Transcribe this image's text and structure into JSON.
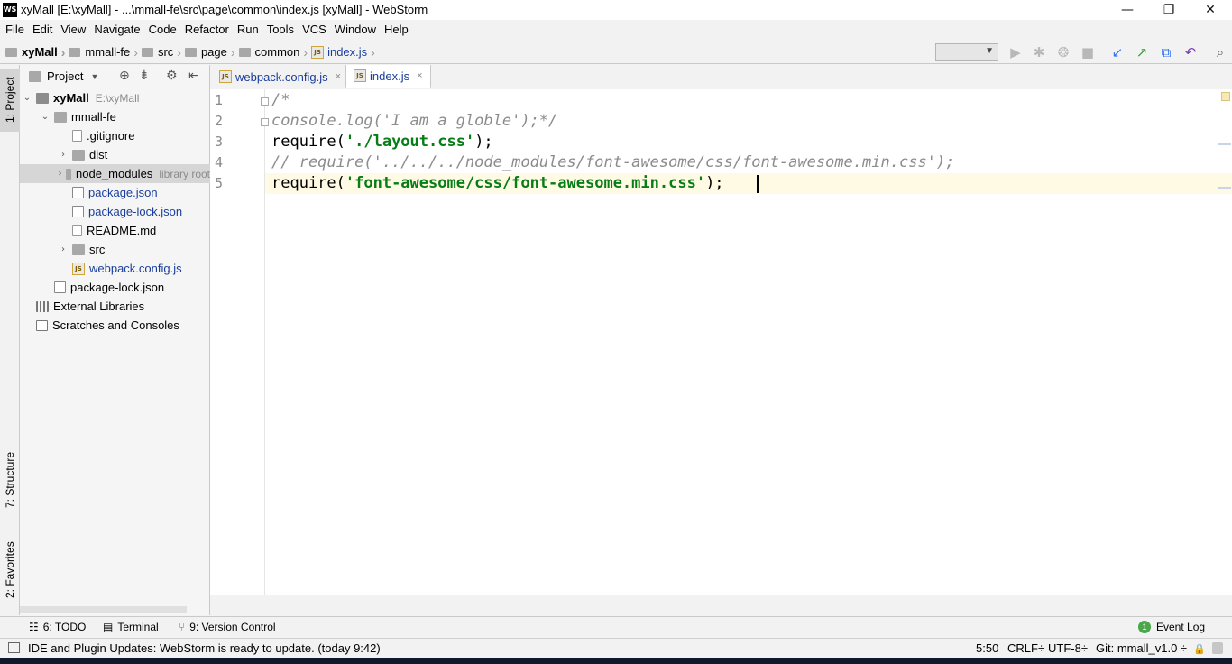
{
  "window": {
    "app_icon_text": "WS",
    "title": "xyMall [E:\\xyMall] - ...\\mmall-fe\\src\\page\\common\\index.js [xyMall] - WebStorm",
    "controls": [
      "—",
      "❐",
      "✕"
    ]
  },
  "menu": [
    "File",
    "Edit",
    "View",
    "Navigate",
    "Code",
    "Refactor",
    "Run",
    "Tools",
    "VCS",
    "Window",
    "Help"
  ],
  "breadcrumb": [
    "xyMall",
    "mmall-fe",
    "src",
    "page",
    "common",
    "index.js"
  ],
  "toolbar_icons": [
    "run-icon",
    "debug-icon",
    "coverage-icon",
    "stop-icon",
    "vcs-update-icon",
    "vcs-commit-icon",
    "compare-icon",
    "revert-icon",
    "search-icon"
  ],
  "left_stripe": {
    "project": "1: Project",
    "structure": "7: Structure",
    "favorites": "2: Favorites"
  },
  "project_panel": {
    "title": "Project",
    "tree": [
      {
        "label": "xyMall",
        "hint": "E:\\xyMall",
        "indent": 0,
        "chevron": "down"
      },
      {
        "label": "mmall-fe",
        "hint": "",
        "indent": 1,
        "chevron": "down"
      },
      {
        "label": ".gitignore",
        "hint": "",
        "indent": 2,
        "chevron": ""
      },
      {
        "label": "dist",
        "hint": "",
        "indent": 2,
        "chevron": "right"
      },
      {
        "label": "node_modules",
        "hint": "library root",
        "indent": 2,
        "chevron": "right"
      },
      {
        "label": "package.json",
        "hint": "",
        "indent": 2,
        "chevron": ""
      },
      {
        "label": "package-lock.json",
        "hint": "",
        "indent": 2,
        "chevron": ""
      },
      {
        "label": "README.md",
        "hint": "",
        "indent": 2,
        "chevron": ""
      },
      {
        "label": "src",
        "hint": "",
        "indent": 2,
        "chevron": "right"
      },
      {
        "label": "webpack.config.js",
        "hint": "",
        "indent": 2,
        "chevron": ""
      },
      {
        "label": "package-lock.json",
        "hint": "",
        "indent": 1,
        "chevron": ""
      },
      {
        "label": "External Libraries",
        "hint": "",
        "indent": 0,
        "chevron": ""
      },
      {
        "label": "Scratches and Consoles",
        "hint": "",
        "indent": 0,
        "chevron": ""
      }
    ]
  },
  "editor_tabs": [
    {
      "label": "webpack.config.js",
      "close": "×"
    },
    {
      "label": "index.js",
      "close": "×"
    }
  ],
  "code": {
    "line_numbers": [
      "1",
      "2",
      "3",
      "4",
      "5"
    ],
    "l1": "/*",
    "l2": "console.log('I am a globle');*/",
    "l3_a": "require(",
    "l3_s": "'./layout.css'",
    "l3_b": ");",
    "l4": "// require('../../../node_modules/font-awesome/css/font-awesome.min.css');",
    "l5_a": "require(",
    "l5_s": "'font-awesome/css/font-awesome.min.css'",
    "l5_b": ");"
  },
  "tool_tabs": {
    "todo": "6: TODO",
    "terminal": "Terminal",
    "vcs": "9: Version Control",
    "event_badge": "1",
    "event_log": "Event Log"
  },
  "status": {
    "message": "IDE and Plugin Updates: WebStorm is ready to update. (today 9:42)",
    "position": "5:50",
    "line_sep": "CRLF÷",
    "encoding": "UTF-8÷",
    "git": "Git: mmall_v1.0 ÷"
  }
}
